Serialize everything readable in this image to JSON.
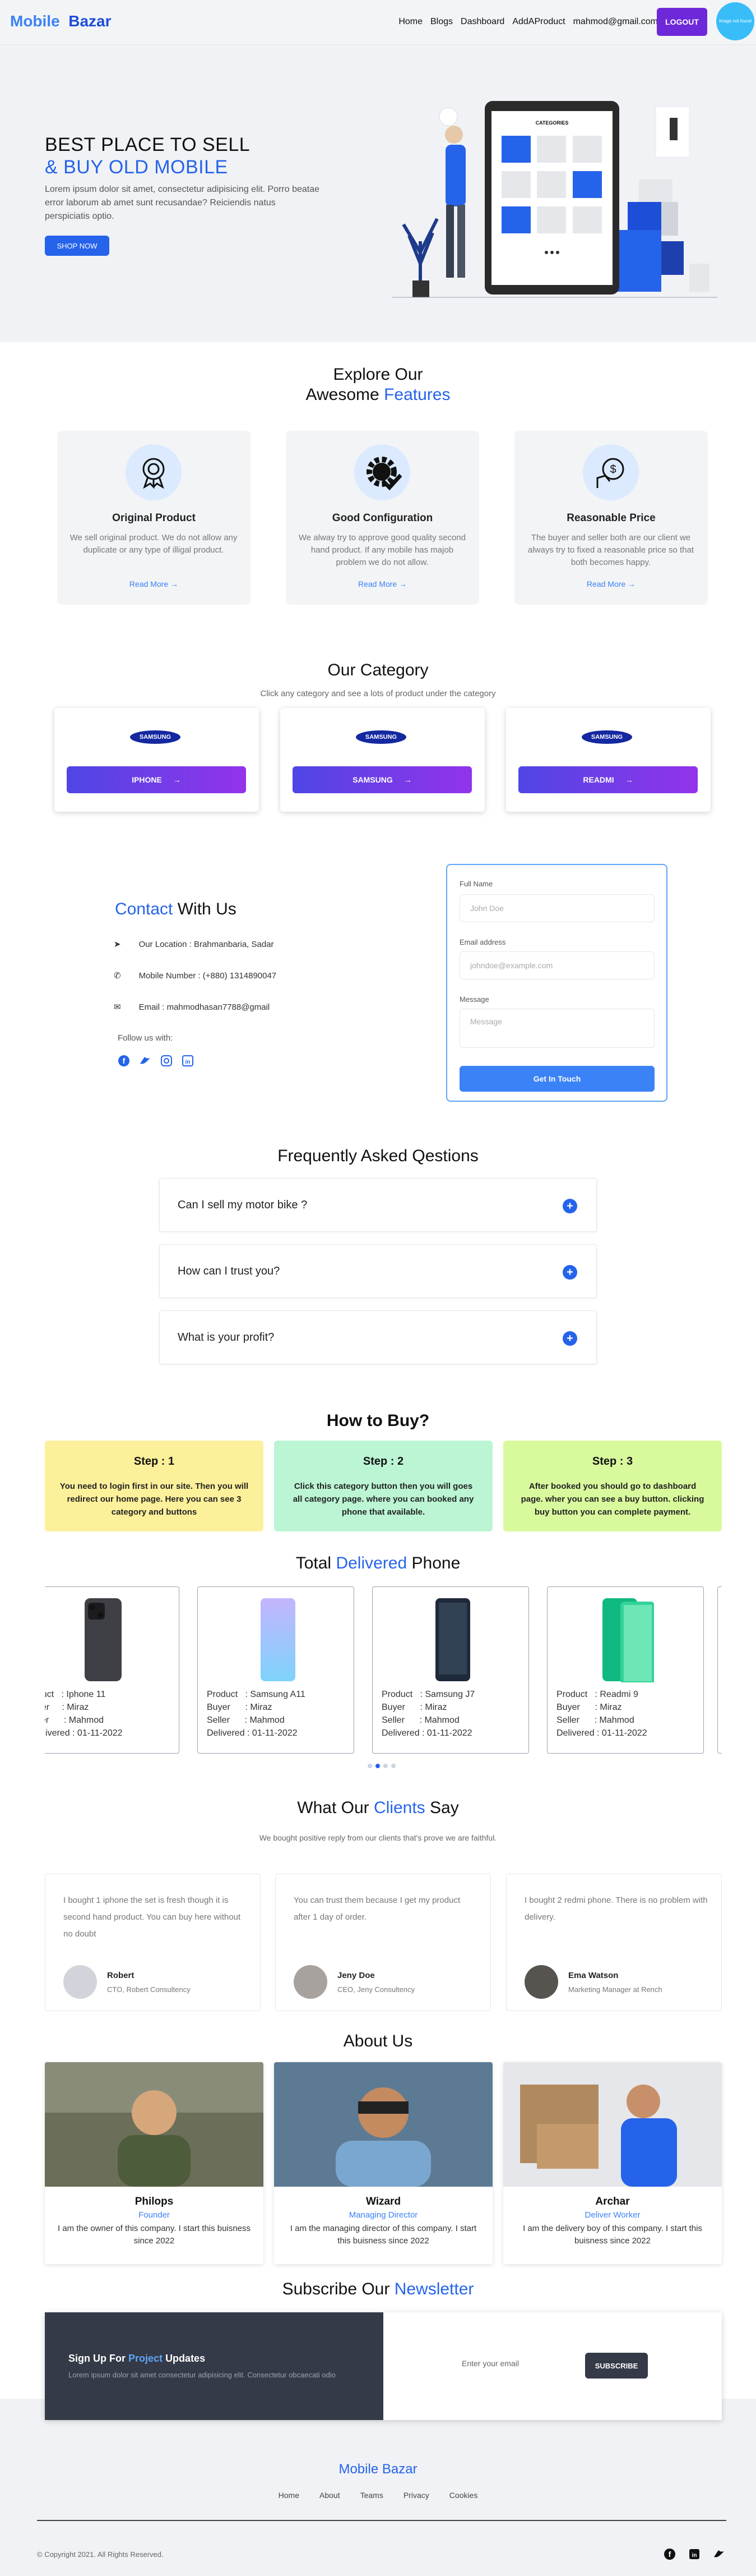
{
  "nav": {
    "logo_part1": "Mobile",
    "logo_part2": "Bazar",
    "links": [
      "Home",
      "Blogs",
      "Dashboard",
      "AddAProduct",
      "mahmod@gmail.com"
    ],
    "logout_label": "LOGOUT",
    "avatar_text": "Image not found"
  },
  "hero": {
    "title_line1": "BEST PLACE TO SELL",
    "title_line2": "& BUY OLD MOBILE",
    "description": "Lorem ipsum dolor sit amet, consectetur adipisicing elit. Porro beatae error laborum ab amet sunt recusandae? Reiciendis natus perspiciatis optio.",
    "cta": "SHOP NOW",
    "phone_header": "CATEGORIES"
  },
  "features": {
    "title_line1": "Explore Our",
    "title_line2_a": "Awesome",
    "title_line2_b": "Features",
    "items": [
      {
        "title": "Original Product",
        "desc": "We sell original product. We do not allow any duplicate or any type of illigal product.",
        "link": "Read More"
      },
      {
        "title": "Good Configuration",
        "desc": "We alway try to approve good quality second hand product. If any mobile has majob problem we do not allow.",
        "link": "Read More"
      },
      {
        "title": "Reasonable Price",
        "desc": "The buyer and seller both are our client we always try to fixed a reasonable price so that both becomes happy.",
        "link": "Read More"
      }
    ]
  },
  "category": {
    "title": "Our Category",
    "subtitle": "Click any category and see a lots of product under the category",
    "items": [
      {
        "logo": "SAMSUNG",
        "label": "IPHONE"
      },
      {
        "logo": "SAMSUNG",
        "label": "SAMSUNG"
      },
      {
        "logo": "SAMSUNG",
        "label": "READMI"
      }
    ]
  },
  "contact": {
    "title_a": "Contact",
    "title_b": "With Us",
    "location": "Our Location : Brahmanbaria, Sadar",
    "phone": "Mobile Number : (+880) 1314890047",
    "email": "Email : mahmodhasan7788@gmail",
    "follow": "Follow us with:",
    "form": {
      "name_label": "Full Name",
      "name_placeholder": "John Doe",
      "email_label": "Email address",
      "email_placeholder": "johndoe@example.com",
      "message_label": "Message",
      "message_placeholder": "Message",
      "submit": "Get In Touch"
    }
  },
  "faq": {
    "title": "Frequently Asked Qestions",
    "items": [
      "Can I sell my motor bike ?",
      "How can I trust you?",
      "What is your profit?"
    ]
  },
  "howto": {
    "title": "How to Buy?",
    "steps": [
      {
        "title": "Step : 1",
        "desc": "You need to login first in our site. Then you will redirect our home page. Here you can see 3 category and buttons",
        "color": "#fdf09a"
      },
      {
        "title": "Step : 2",
        "desc": "Click this category button then you will goes all category page. where you can booked any phone that available.",
        "color": "#bbf5d4"
      },
      {
        "title": "Step : 3",
        "desc": "After booked you should go to dashboard page. wher you can see a buy button. clicking buy button you can complete payment.",
        "color": "#d9f99d"
      }
    ]
  },
  "delivered": {
    "title_a": "Total",
    "title_b": "Delivered",
    "title_c": "Phone",
    "items": [
      {
        "info": "oduct   : Iphone 11\nuyer     : Miraz\neller      : Mahmod\nDelivered : 01-11-2022"
      },
      {
        "info": "Product   : Samsung A11\nBuyer      : Miraz\nSeller      : Mahmod\nDelivered : 01-11-2022"
      },
      {
        "info": "Product   : Samsung J7\nBuyer      : Miraz\nSeller      : Mahmod\nDelivered : 01-11-2022"
      },
      {
        "info": "Product   : Readmi 9\nBuyer      : Miraz\nSeller      : Mahmod\nDelivered : 01-11-2022"
      }
    ]
  },
  "clients": {
    "title_a": "What Our",
    "title_b": "Clients",
    "title_c": "Say",
    "subtitle": "We bought positive reply from our clients that's prove we are faithful.",
    "items": [
      {
        "text": "I bought 1 iphone the set is fresh though it is second hand product. You can buy here without no doubt",
        "name": "Robert",
        "role": "CTO, Robert Consultency"
      },
      {
        "text": "You can trust them because I get my product after 1 day of order.",
        "name": "Jeny Doe",
        "role": "CEO, Jeny Consultency"
      },
      {
        "text": "I bought 2 redmi phone. There is no problem with delivery.",
        "name": "Ema Watson",
        "role": "Marketing Manager at Rench"
      }
    ]
  },
  "about": {
    "title": "About Us",
    "items": [
      {
        "name": "Philops",
        "role": "Founder",
        "desc": "I am the owner of this company. I start this buisness since 2022"
      },
      {
        "name": "Wizard",
        "role": "Managing Director",
        "desc": "I am the managing director of this company. I start this buisness since 2022"
      },
      {
        "name": "Archar",
        "role": "Deliver Worker",
        "desc": "I am the delivery boy of this company. I start this buisness since 2022"
      }
    ]
  },
  "newsletter": {
    "title_a": "Subscribe Our",
    "title_b": "Newsletter",
    "box_title_a": "Sign Up For",
    "box_title_b": "Project",
    "box_title_c": "Updates",
    "box_desc": "Lorem ipsum dolor sit amet consectetur adipisicing elit. Consectetur obcaecati odio",
    "input_placeholder": "Enter your email",
    "button": "SUBSCRIBE"
  },
  "footer": {
    "brand": "Mobile Bazar",
    "links": [
      "Home",
      "About",
      "Teams",
      "Privacy",
      "Cookies"
    ],
    "copyright": "© Copyright 2021. All Rights Reserved."
  }
}
